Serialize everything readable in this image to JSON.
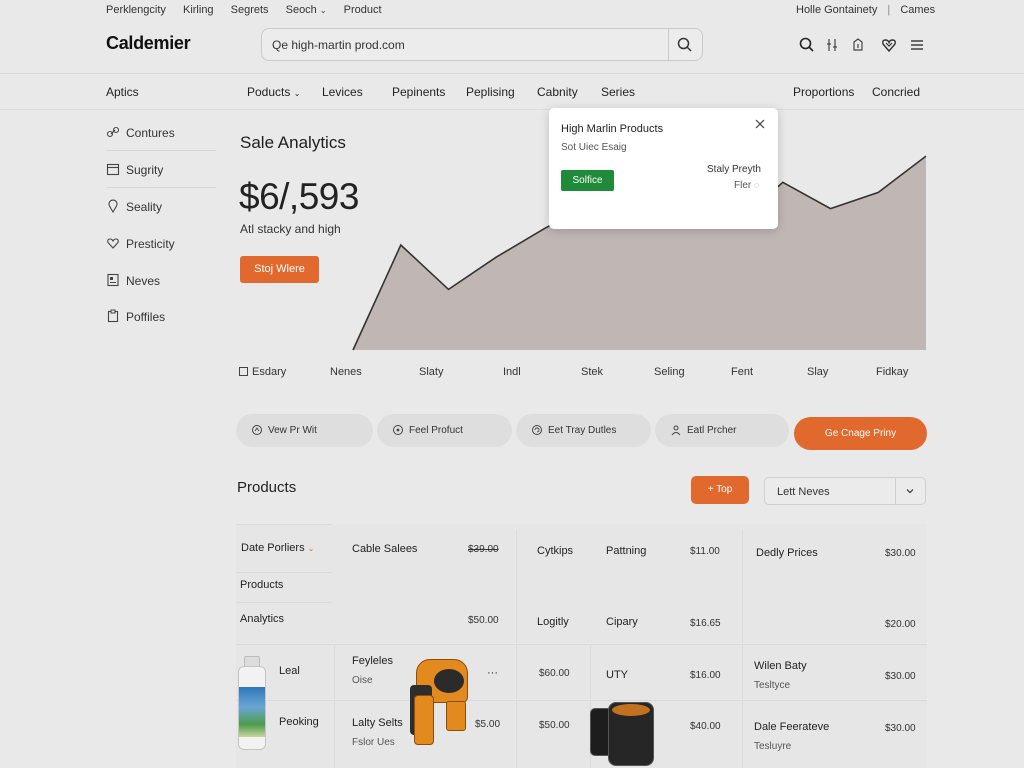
{
  "util_bar": {
    "left": [
      "Perklengcity",
      "Kirling",
      "Segrets",
      "Seoch",
      "Product"
    ],
    "right": [
      "Holle Gontainety",
      "Cames"
    ]
  },
  "header": {
    "logo": "Caldemier",
    "search_value": "Qe high-martin prod.com",
    "icons": [
      "search-icon",
      "filter-icon",
      "cart-icon",
      "home-icon",
      "heart-icon",
      "menu-icon"
    ]
  },
  "nav": {
    "section": "Aptics",
    "items": [
      "Poducts",
      "Levices",
      "Pepinents",
      "Peplising",
      "Cabnity",
      "Series"
    ],
    "right_items": [
      "Proportions",
      "Concried"
    ]
  },
  "sidebar": {
    "items": [
      {
        "label": "Contures",
        "icon": "link-icon"
      },
      {
        "label": "Sugrity",
        "icon": "calendar-icon"
      },
      {
        "label": "Seality",
        "icon": "location-pin-icon"
      },
      {
        "label": "Presticity",
        "icon": "heart-outline-icon"
      },
      {
        "label": "Neves",
        "icon": "news-icon"
      },
      {
        "label": "Poffiles",
        "icon": "clipboard-icon"
      }
    ]
  },
  "analytics": {
    "title": "Sale Analytics",
    "value": "$6/,593",
    "subtitle": "Atl stacky and high",
    "button": "Stoj Wlere"
  },
  "chart_data": {
    "type": "area",
    "x": [
      "Esdary",
      "Nenes",
      "Slaty",
      "Indl",
      "Stek",
      "Seling",
      "Fent",
      "Slay",
      "Fidkay"
    ],
    "values": [
      0,
      52,
      30,
      46,
      60,
      73,
      72,
      80,
      62,
      83,
      70,
      78,
      96
    ],
    "title": "",
    "xlabel": "",
    "ylabel": "",
    "color": "#b9aeab",
    "line_color": "#333333"
  },
  "popup": {
    "title": "High Marlin Products",
    "subtitle": "Sot Uiec Esaig",
    "button": "Solfice",
    "right_line1": "Staly Preyth",
    "right_line2": "Fler"
  },
  "pills": [
    {
      "label": "Vew Pr Wit",
      "icon": "chat-icon"
    },
    {
      "label": "Feel Profuct",
      "icon": "tag-icon"
    },
    {
      "label": "Eet Tray Dutles",
      "icon": "refresh-icon"
    },
    {
      "label": "Eatl Prcher",
      "icon": "user-icon"
    }
  ],
  "pill_cta": "Ge Cnage Priny",
  "products": {
    "title": "Products",
    "add_button": "+ Top",
    "select_value": "Lett Neves",
    "header_row": {
      "c1": "Date Porliers",
      "c2": "Cable Salees",
      "c3": "$39.00",
      "c4": "Cytkips",
      "c5": "Pattning",
      "c6": "$11.00",
      "c7": "Dedly Prices",
      "c8": "$30.00"
    },
    "row2": {
      "c1": "Products"
    },
    "row3": {
      "c1": "Analytics",
      "c3": "$50.00",
      "c4": "Logitly",
      "c5": "Cipary",
      "c6": "$16.65",
      "c8": "$20.00"
    },
    "row4": {
      "c1": "Leal",
      "c2a": "Feyleles",
      "c2b": "Oise",
      "dots": "···",
      "c3": "$60.00",
      "c5": "UTY",
      "c6": "$16.00",
      "c7a": "Wilen Baty",
      "c7b": "Tesltyce",
      "c8": "$30.00"
    },
    "row5": {
      "c1": "Peoking",
      "c2a": "Lalty Selts",
      "c2b": "Fslor Ues",
      "c2c": "$5.00",
      "c3": "$50.00",
      "c6": "$40.00",
      "c7a": "Dale Feerateve",
      "c7b": "Tesluyre",
      "c8": "$30.00"
    }
  }
}
